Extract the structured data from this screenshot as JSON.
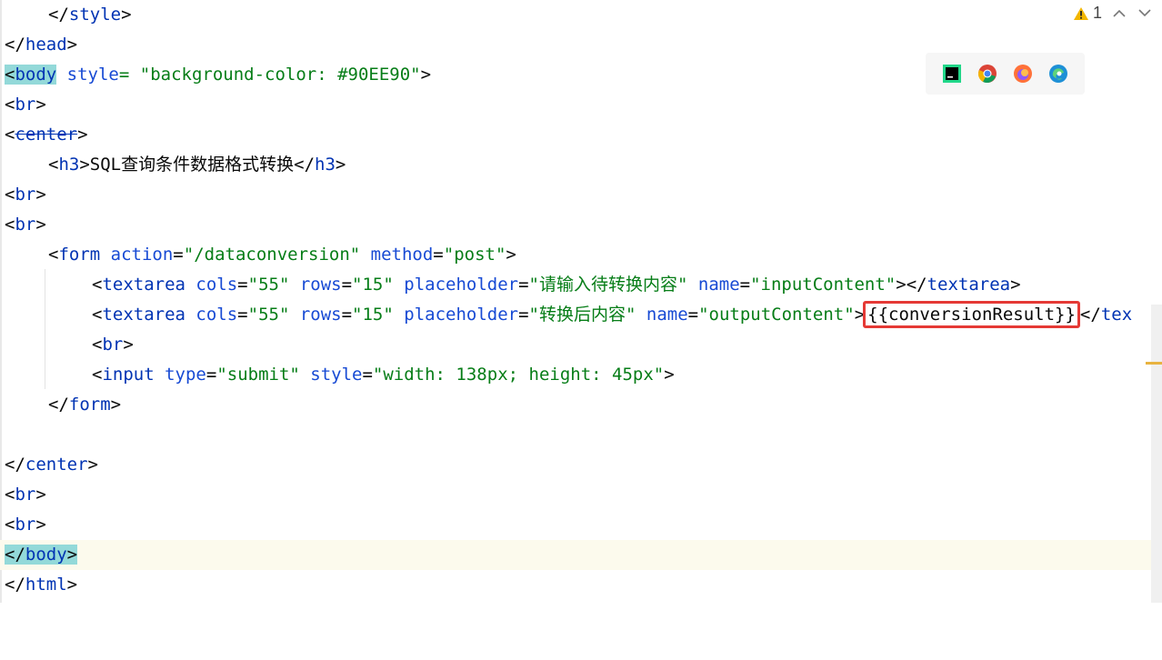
{
  "inspection": {
    "warning_count": "1"
  },
  "code": {
    "l1": {
      "open": "</",
      "tag": "style",
      "close": ">"
    },
    "l2": {
      "open": "</",
      "tag": "head",
      "close": ">"
    },
    "l3": {
      "open": "<",
      "tag": "body",
      "attr": " style",
      "eq": "= ",
      "val": "\"background-color: #90EE90\"",
      "close": ">"
    },
    "l4": {
      "open": "<",
      "tag": "br",
      "close": ">"
    },
    "l5": {
      "open": "<",
      "tag": "center",
      "close": ">"
    },
    "l6": {
      "open": "<",
      "tag": "h3",
      "close": ">",
      "text": "SQL查询条件数据格式转换",
      "eopen": "</",
      "etag": "h3",
      "eclose": ">"
    },
    "l7": {
      "open": "<",
      "tag": "br",
      "close": ">"
    },
    "l8": {
      "open": "<",
      "tag": "br",
      "close": ">"
    },
    "l9": {
      "open": "<",
      "tag": "form",
      "a1": " action",
      "v1": "\"/dataconversion\"",
      "a2": " method",
      "v2": "\"post\"",
      "close": ">"
    },
    "l10": {
      "open": "<",
      "tag": "textarea",
      "a1": " cols",
      "v1": "\"55\"",
      "a2": " rows",
      "v2": "\"15\"",
      "a3": " placeholder",
      "v3": "\"请输入待转换内容\"",
      "a4": " name",
      "v4": "\"inputContent\"",
      "close": "></",
      "etag": "textarea",
      "eclose": ">"
    },
    "l11": {
      "open": "<",
      "tag": "textarea",
      "a1": " cols",
      "v1": "\"55\"",
      "a2": " rows",
      "v2": "\"15\"",
      "a3": " placeholder",
      "v3": "\"转换后内容\"",
      "a4": " name",
      "v4": "\"outputContent\"",
      "close": ">",
      "text": "{{conversionResult}}",
      "eopen": "</",
      "etag": "tex"
    },
    "l12": {
      "open": "<",
      "tag": "br",
      "close": ">"
    },
    "l13": {
      "open": "<",
      "tag": "input",
      "a1": " type",
      "v1": "\"submit\"",
      "a2": " style",
      "v2": "\"width: 138px; height: 45px\"",
      "close": ">"
    },
    "l14": {
      "open": "</",
      "tag": "form",
      "close": ">"
    },
    "l16": {
      "open": "</",
      "tag": "center",
      "close": ">"
    },
    "l17": {
      "open": "<",
      "tag": "br",
      "close": ">"
    },
    "l18": {
      "open": "<",
      "tag": "br",
      "close": ">"
    },
    "l19": {
      "open": "</",
      "tag": "body",
      "close": ">"
    },
    "l20": {
      "open": "</",
      "tag": "html",
      "close": ">"
    },
    "eq": "="
  },
  "browsers": [
    "pycharm-icon",
    "chrome-icon",
    "firefox-icon",
    "edge-icon"
  ],
  "colors": {
    "tag": "#0033b3",
    "string": "#067d17",
    "highlight": "#e53935",
    "current_line": "#fcfaed"
  }
}
